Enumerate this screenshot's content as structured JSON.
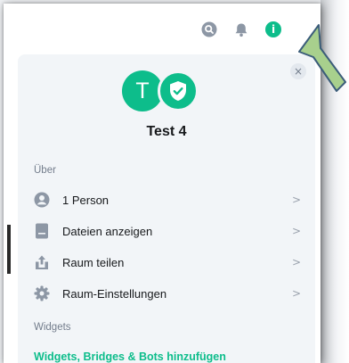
{
  "header": {
    "icons": [
      "search-icon",
      "bell-icon",
      "info-icon"
    ],
    "info_glyph": "i",
    "accent": "#0dbd8b"
  },
  "panel": {
    "close_glyph": "×",
    "avatar_letter": "T",
    "room_name": "Test 4",
    "about_title": "Über",
    "items": [
      {
        "icon": "person-icon",
        "label": "1 Person"
      },
      {
        "icon": "file-icon",
        "label": "Dateien anzeigen"
      },
      {
        "icon": "share-icon",
        "label": "Raum teilen"
      },
      {
        "icon": "gear-icon",
        "label": "Raum-Einstellungen"
      }
    ],
    "chevron": ">",
    "widgets_title": "Widgets",
    "widgets_link": "Widgets, Bridges & Bots hinzufügen"
  },
  "annotation": {
    "type": "arrow",
    "color": "#a8d08d",
    "stroke": "#3b5d7a"
  }
}
